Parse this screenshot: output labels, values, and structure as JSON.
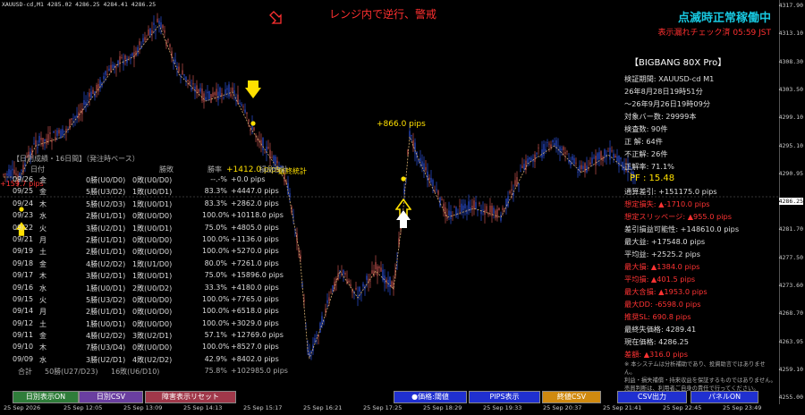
{
  "header": {
    "symbol_info": "XAUUSD-cd,M1  4285.02 4286.25 4284.41 4286.25",
    "warning": "レンジ内で逆行、警戒",
    "status_main": "点滅時正常稼働中",
    "status_sub": "表示漏れチェック済  05:59 JST"
  },
  "price_axis": {
    "ticks": [
      "4317.90",
      "4313.10",
      "4308.30",
      "4303.50",
      "4299.10",
      "4295.10",
      "4290.95",
      "4286.25",
      "4281.70",
      "4277.50",
      "4273.60",
      "4268.70",
      "4263.95",
      "4259.10",
      "4255.00"
    ],
    "current_price": "4286.25"
  },
  "time_axis": [
    "25 Sep 2026",
    "25 Sep 12:05",
    "25 Sep 13:09",
    "25 Sep 14:13",
    "25 Sep 15:17",
    "25 Sep 16:21",
    "25 Sep 17:25",
    "25 Sep 18:29",
    "25 Sep 19:33",
    "25 Sep 20:37",
    "25 Sep 21:41",
    "25 Sep 22:45",
    "25 Sep 23:49"
  ],
  "chart_labels": {
    "pips_866": "+866.0 pips",
    "pips_1412": "+1412.0 pips",
    "overlay_1": "最終統計",
    "overlay_left": "+159.7 pips"
  },
  "stats_panel": {
    "title": "【BIGBANG 80X Pro】",
    "rows": [
      {
        "text": "検証期間:  XAUUSD-cd M1",
        "red": false
      },
      {
        "text": "26年8月28日19時51分",
        "red": false
      },
      {
        "text": "〜26年9月26日19時09分",
        "red": false
      },
      {
        "text": "対象バー数: 29999本",
        "red": false
      },
      {
        "text": "検査数: 90件",
        "red": false
      },
      {
        "text": "正  解: 64件",
        "red": false
      },
      {
        "text": "不正解: 26件",
        "red": false
      },
      {
        "text": "正解率: 71.1%",
        "red": false
      }
    ],
    "pf": "PF  :  15.48",
    "rows2": [
      {
        "text": "通算差引: +151175.0 pips",
        "red": false
      },
      {
        "text": "想定損失: ▲-1710.0 pips",
        "red": true
      },
      {
        "text": "想定スリッページ: ▲955.0 pips",
        "red": true
      },
      {
        "text": "差引損益可能性: +148610.0 pips",
        "red": false
      },
      {
        "text": "最大益: +17548.0 pips",
        "red": false
      },
      {
        "text": "平均益: +2525.2 pips",
        "red": false
      },
      {
        "text": "最大損: ▲1384.0 pips",
        "red": true
      },
      {
        "text": "平均損: ▲401.5 pips",
        "red": true
      },
      {
        "text": "最大含損: ▲1953.0 pips",
        "red": true
      },
      {
        "text": "最大DD: -6598.0 pips",
        "red": true
      },
      {
        "text": "推奨SL: 690.8 pips",
        "red": true
      },
      {
        "text": "最終失価格: 4289.41",
        "red": false
      },
      {
        "text": "現在価格: 4286.25",
        "red": false
      },
      {
        "text": "差額: ▲316.0 pips",
        "red": true
      }
    ],
    "note1": "※ 本システムは分析補助であり、投資助言ではありません。",
    "note2": "利益・損失補償・持来収益を保証するものではありません。",
    "note3": "売買判断は、利用者ご自身の責任で行ってください。"
  },
  "daily_table": {
    "title": "【日別成績・16日間】（発注時ベース）",
    "headers": {
      "date": "日付",
      "wl": "勝敗",
      "rate": "勝率",
      "pips": "損益合計"
    },
    "rows": [
      {
        "date": "09/26",
        "dow": "金",
        "w": "0勝(U0/D0)",
        "l": "0敗(U0/D0)",
        "rate": "--.-%",
        "pips": "+0.0 pips"
      },
      {
        "date": "09/25",
        "dow": "金",
        "w": "5勝(U3/D2)",
        "l": "1敗(U0/D1)",
        "rate": "83.3%",
        "pips": "+4447.0 pips"
      },
      {
        "date": "09/24",
        "dow": "木",
        "w": "5勝(U2/D3)",
        "l": "1敗(U0/D1)",
        "rate": "83.3%",
        "pips": "+2862.0 pips"
      },
      {
        "date": "09/23",
        "dow": "水",
        "w": "2勝(U1/D1)",
        "l": "0敗(U0/D0)",
        "rate": "100.0%",
        "pips": "+10118.0 pips"
      },
      {
        "date": "09/22",
        "dow": "火",
        "w": "3勝(U2/D1)",
        "l": "1敗(U0/D1)",
        "rate": "75.0%",
        "pips": "+4805.0 pips"
      },
      {
        "date": "09/21",
        "dow": "月",
        "w": "2勝(U1/D1)",
        "l": "0敗(U0/D0)",
        "rate": "100.0%",
        "pips": "+1136.0 pips"
      },
      {
        "date": "09/19",
        "dow": "土",
        "w": "2勝(U1/D1)",
        "l": "0敗(U0/D0)",
        "rate": "100.0%",
        "pips": "+5270.0 pips"
      },
      {
        "date": "09/18",
        "dow": "金",
        "w": "4勝(U2/D2)",
        "l": "1敗(U1/D0)",
        "rate": "80.0%",
        "pips": "+7261.0 pips"
      },
      {
        "date": "09/17",
        "dow": "木",
        "w": "3勝(U2/D1)",
        "l": "1敗(U0/D1)",
        "rate": "75.0%",
        "pips": "+15896.0 pips"
      },
      {
        "date": "09/16",
        "dow": "水",
        "w": "1勝(U0/D1)",
        "l": "2敗(U0/D2)",
        "rate": "33.3%",
        "pips": "+4180.0 pips"
      },
      {
        "date": "09/15",
        "dow": "火",
        "w": "5勝(U3/D2)",
        "l": "0敗(U0/D0)",
        "rate": "100.0%",
        "pips": "+7765.0 pips"
      },
      {
        "date": "09/14",
        "dow": "月",
        "w": "2勝(U1/D1)",
        "l": "0敗(U0/D0)",
        "rate": "100.0%",
        "pips": "+6518.0 pips"
      },
      {
        "date": "09/12",
        "dow": "土",
        "w": "1勝(U0/D1)",
        "l": "0敗(U0/D0)",
        "rate": "100.0%",
        "pips": "+3029.0 pips"
      },
      {
        "date": "09/11",
        "dow": "金",
        "w": "4勝(U2/D2)",
        "l": "3敗(U2/D1)",
        "rate": "57.1%",
        "pips": "+12769.0 pips"
      },
      {
        "date": "09/10",
        "dow": "木",
        "w": "7勝(U3/D4)",
        "l": "0敗(U0/D0)",
        "rate": "100.0%",
        "pips": "+8527.0 pips"
      },
      {
        "date": "09/09",
        "dow": "水",
        "w": "3勝(U2/D1)",
        "l": "4敗(U2/D2)",
        "rate": "42.9%",
        "pips": "+8402.0 pips"
      }
    ],
    "total": {
      "label": "合計",
      "w": "50勝(U27/D23)",
      "l": "16敗(U6/D10)",
      "rate": "75.8%",
      "pips": "+102985.0 pips"
    }
  },
  "buttons": [
    {
      "label": "日別表示ON",
      "bg": "#2f7d3a"
    },
    {
      "label": "日別CSV",
      "bg": "#6a3fa0"
    },
    {
      "label": "障害表示リセット",
      "bg": "#a0384a"
    },
    {
      "label": "●価格:閾値",
      "bg": "#2030d0"
    },
    {
      "label": "PIPS表示",
      "bg": "#2030d0"
    },
    {
      "label": "終値CSV",
      "bg": "#d08a10"
    },
    {
      "label": "CSV出力",
      "bg": "#2030d0"
    },
    {
      "label": "パネルON",
      "bg": "#2030d0"
    }
  ],
  "colors": {
    "bull": "#2c4fd8",
    "bear": "#c0504d",
    "ma": "#d8b070",
    "accent": "#ffe000"
  }
}
